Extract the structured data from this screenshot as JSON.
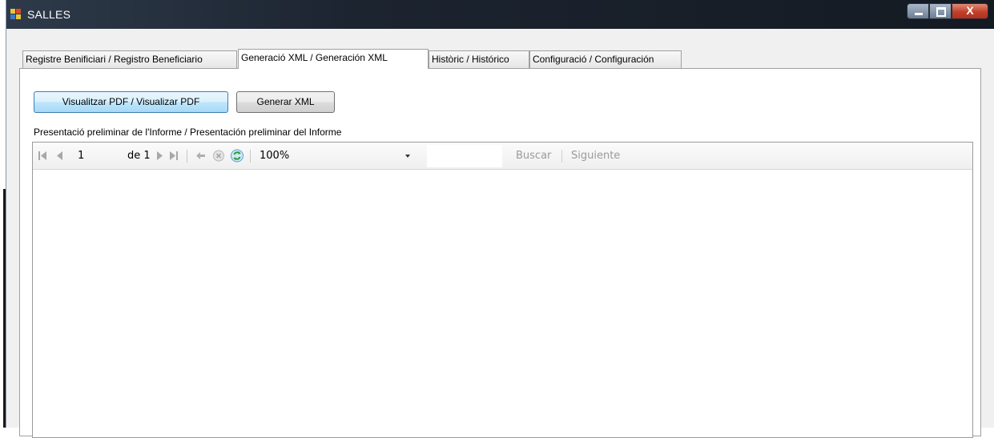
{
  "window": {
    "title": "SALLES",
    "controls": {
      "close_glyph": "X"
    }
  },
  "tabs": [
    {
      "label": "Registre Benificiari / Registro Beneficiario",
      "active": false
    },
    {
      "label": "Generació XML / Generación XML",
      "active": true
    },
    {
      "label": "Històric / Histórico",
      "active": false
    },
    {
      "label": "Configuració / Configuración",
      "active": false
    }
  ],
  "actions": {
    "view_pdf_label": "Visualitzar PDF / Visualizar PDF",
    "generate_xml_label": "Generar XML"
  },
  "preview": {
    "caption": "Presentació preliminar de l'Informe / Presentación preliminar del Informe"
  },
  "viewer_toolbar": {
    "current_page": "1",
    "of_label": "de 1",
    "zoom": "100%",
    "search_value": "",
    "find_label": "Buscar",
    "find_next_label": "Siguiente",
    "icons": [
      "first-page-icon",
      "previous-page-icon",
      "next-page-icon",
      "last-page-icon",
      "back-icon",
      "stop-icon",
      "refresh-icon",
      "dropdown-arrow-icon"
    ]
  },
  "colors": {
    "titlebar": "#1c2430",
    "close_button": "#c2402a",
    "focused_button": "#bee6fd",
    "refresh_icon": "#2e9a3a"
  }
}
